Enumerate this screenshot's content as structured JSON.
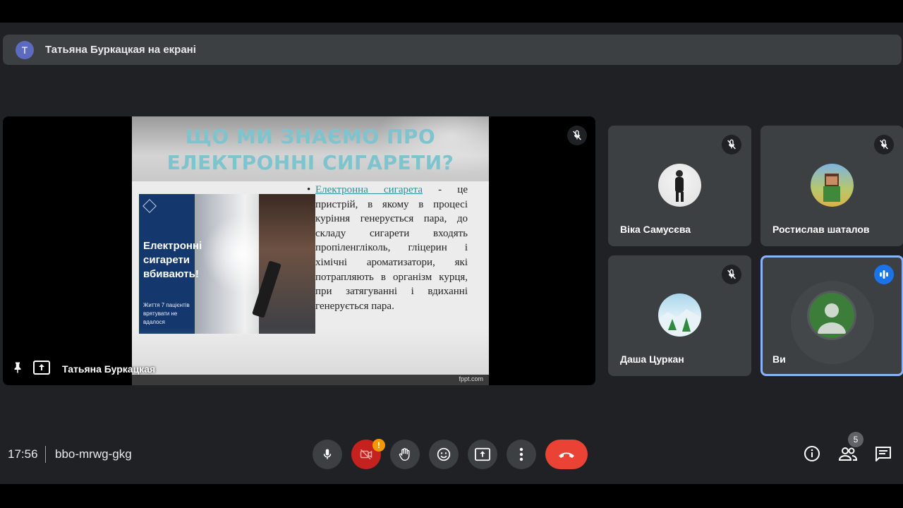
{
  "banner": {
    "avatar_letter": "T",
    "text": "Татьяна Буркацкая на екрані"
  },
  "presentation": {
    "presenter_name": "Татьяна Буркацкая",
    "slide": {
      "title": "ЩО МИ ЗНАЄМО ПРО ЕЛЕКТРОННІ СИГАРЕТИ?",
      "bullet_link": "Електронна сигарета",
      "bullet_text": " - це пристрій, в якому в процесі куріння генерується пара, до складу сигарети входять пропіленгліколь, гліцерин і хімічні ароматизатори, які потрапляють в організм курця, при затягуванні і вдиханні генерується пара.",
      "image_headline": "Електронні сигарети вбивають!",
      "image_subtext": "Життя 7 пацієнтів врятувати не вдалося",
      "footer": "fppt.com"
    }
  },
  "participants": [
    {
      "name": "Віка Самусєва",
      "muted": true
    },
    {
      "name": "Ростислав шаталов",
      "muted": true
    },
    {
      "name": "Даша Цуркан",
      "muted": true
    },
    {
      "name": "Ви",
      "muted": false,
      "speaking": true
    }
  ],
  "bottom_bar": {
    "time": "17:56",
    "meeting_code": "bbo-mrwg-gkg",
    "camera_alert": "!",
    "people_count": "5"
  },
  "colors": {
    "background": "#202124",
    "tile": "#3c4043",
    "hangup": "#ea4335",
    "camera_off": "#c5221f",
    "speaking_border": "#8ab4f8",
    "speaking_badge": "#1a73e8",
    "alert": "#f29900"
  }
}
